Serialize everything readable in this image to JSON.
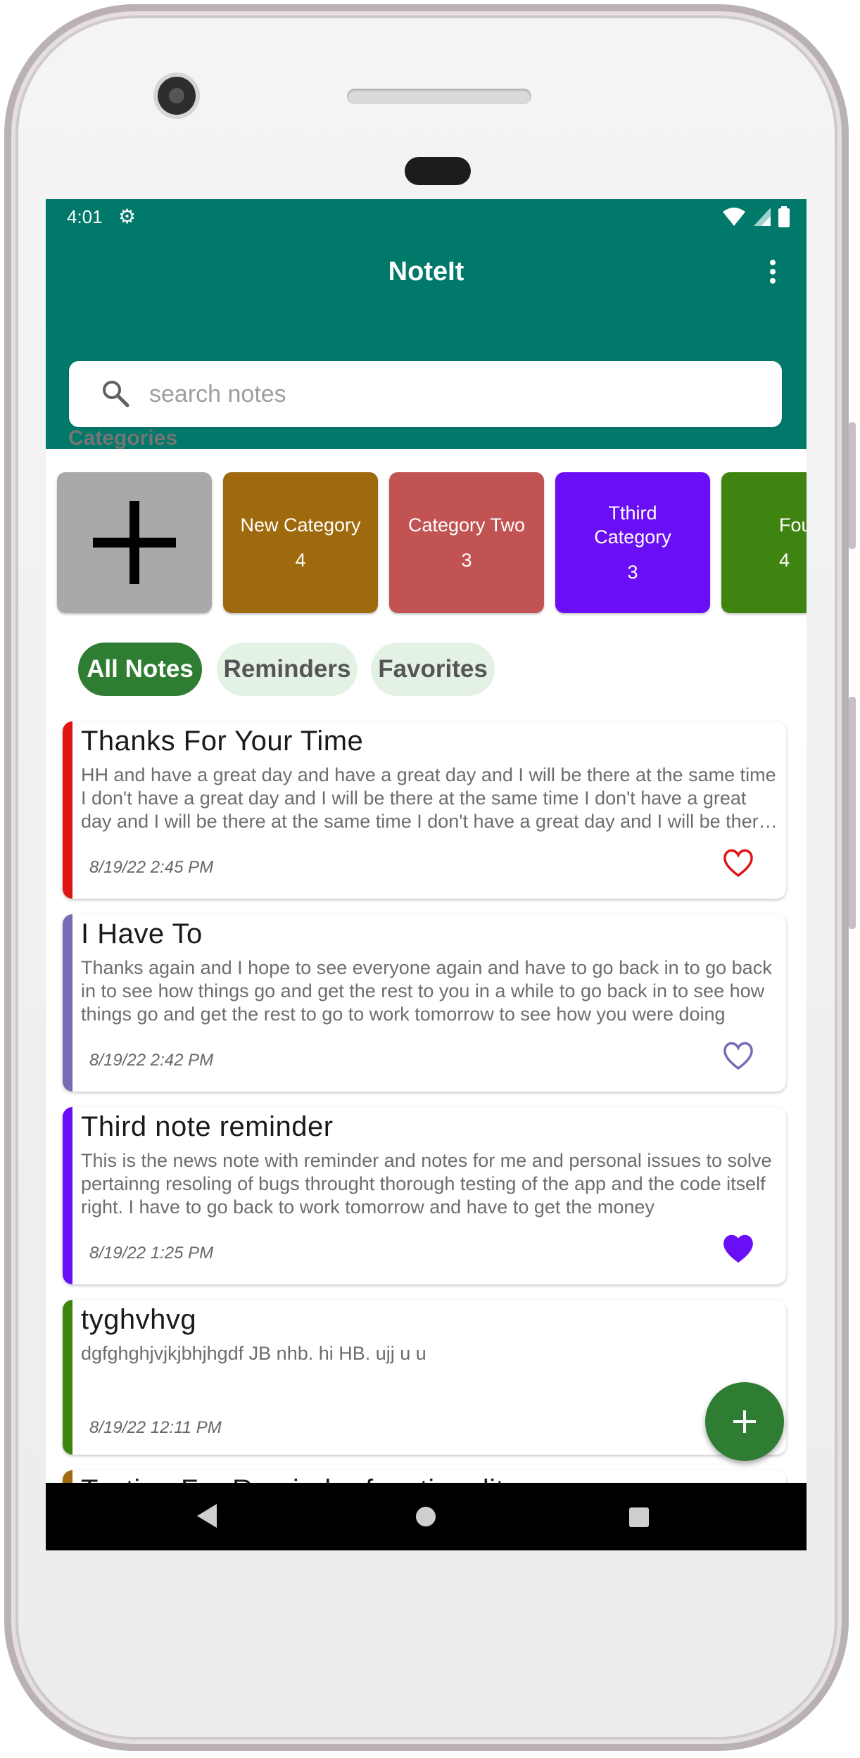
{
  "status_bar": {
    "time": "4:01",
    "settings_icon": "gear-icon",
    "icons": [
      "wifi-icon",
      "signal-icon",
      "battery-icon"
    ]
  },
  "app_bar": {
    "title": "NoteIt",
    "menu_icon": "more-vert-icon",
    "color": "#00796b"
  },
  "search": {
    "placeholder": "search notes",
    "value": "",
    "icon": "search-icon"
  },
  "categories": {
    "title": "Categories",
    "add_icon": "plus-icon",
    "items": [
      {
        "name": "New Category",
        "count": "4",
        "color": "#9e6a0d"
      },
      {
        "name": "Category Two",
        "count": "3",
        "color": "#c25353"
      },
      {
        "name": "Tthird Category",
        "count": "3",
        "color": "#6a0ff5"
      },
      {
        "name": "Fou",
        "count": "4",
        "color": "#3f8410"
      }
    ]
  },
  "filters": {
    "items": [
      {
        "label": "All Notes",
        "active": true
      },
      {
        "label": "Reminders",
        "active": false
      },
      {
        "label": "Favorites",
        "active": false
      }
    ],
    "active_color": "#2e7d32",
    "inactive_color": "#e4f2e5"
  },
  "notes": [
    {
      "title": "Thanks For Your Time",
      "body": "HH and have a great day and have a great day and I will be there at the same time I don't have a great day and I will be there at the same time I don't have a great day and I will be there at the same time I don't have a great day and I will be there at the same time",
      "date": "8/19/22 2:45 PM",
      "color": "#e11414",
      "favorite": false,
      "heart_color": "#e11414"
    },
    {
      "title": "I Have To",
      "body": "Thanks again and I hope to see everyone again and have to go back in to go back in to see how things go and get the rest to you in a while to go back in to see how things go and get the rest to go to work tomorrow to see how you were doing",
      "date": "8/19/22 2:42 PM",
      "color": "#7a6ab5",
      "favorite": false,
      "heart_color": "#7a6ab5"
    },
    {
      "title": "Third note reminder",
      "body": "This is the news note with reminder and notes for me and personal issues to solve pertainng resoling of bugs throught thorough testing of the app and the code itself right. I have to go back to work tomorrow and have to get the money",
      "date": "8/19/22 1:25 PM",
      "color": "#6a0ff5",
      "favorite": true,
      "heart_color": "#6a0ff5"
    },
    {
      "title": "tyghvhvg",
      "body": "dgfghghjvjkjbhjhgdf JB nhb. hi HB. ujj u u",
      "date": "8/19/22 12:11 PM",
      "color": "#3f8410",
      "favorite": false,
      "heart_color": "#3f8410"
    },
    {
      "title": "Testing For Reminder functionality",
      "body": "",
      "date": "",
      "color": "#9e6a0d",
      "favorite": false,
      "heart_color": "#9e6a0d"
    }
  ],
  "fab": {
    "icon": "plus-icon",
    "color": "#2e7d32"
  },
  "nav_bar": {
    "icons": [
      "back-icon",
      "home-icon",
      "recents-icon"
    ]
  }
}
